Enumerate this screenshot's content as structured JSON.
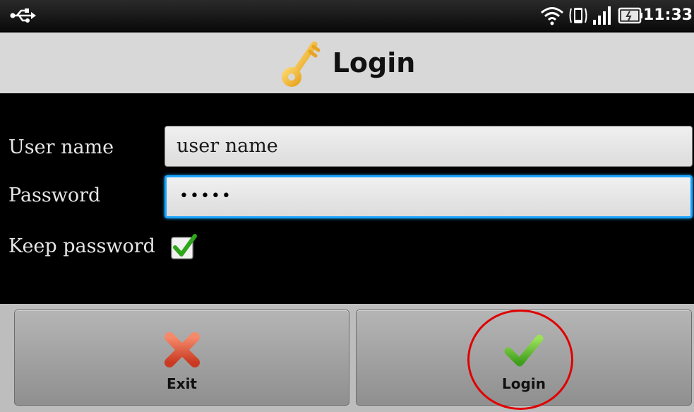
{
  "status_bar": {
    "time": "11:33",
    "icons": [
      "usb-icon",
      "wifi-icon",
      "phone-signal-icon",
      "signal-bars-icon",
      "battery-icon"
    ]
  },
  "title_bar": {
    "title": "Login",
    "icon": "key-icon",
    "icon_color": "#f2b632"
  },
  "form": {
    "username_label": "User name",
    "username_value": "user name",
    "password_label": "Password",
    "password_masked": "•••••",
    "keep_password_label": "Keep password",
    "keep_password_checked": true
  },
  "buttons": {
    "exit_label": "Exit",
    "login_label": "Login"
  },
  "colors": {
    "focus_border": "#1aa3ff",
    "exit_icon": "#e05a3a",
    "login_icon": "#5fc23a",
    "annotation": "#e00000"
  }
}
